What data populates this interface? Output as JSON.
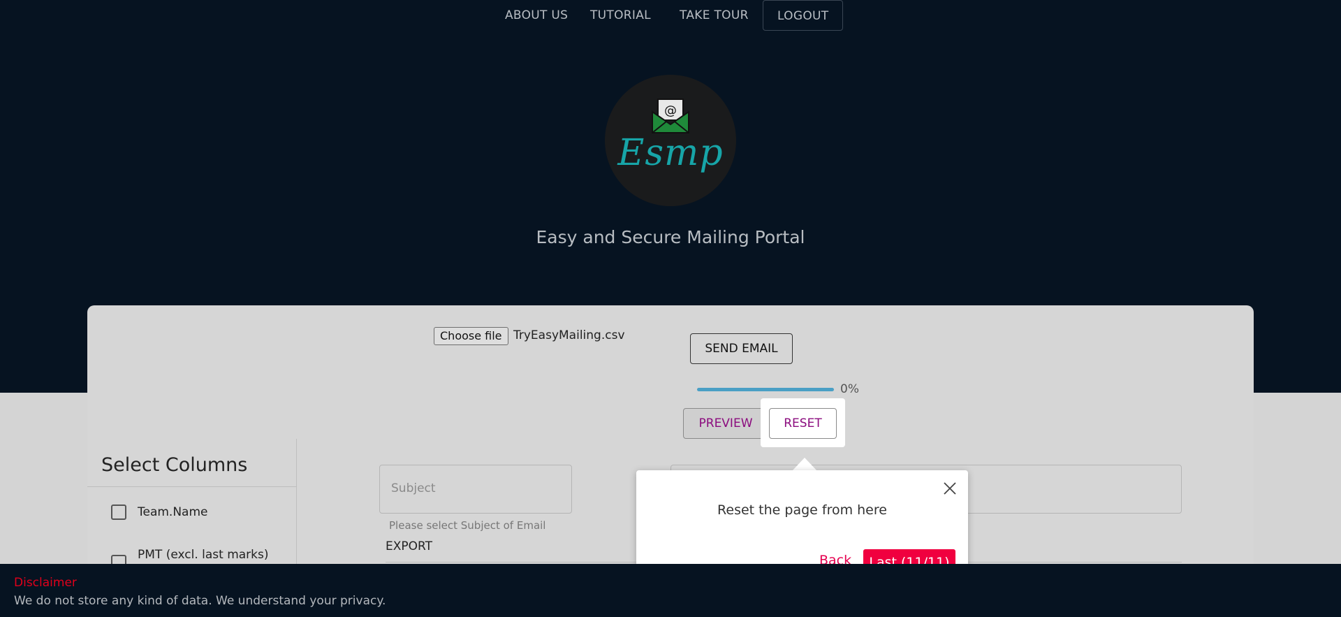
{
  "nav": {
    "items": [
      {
        "label": "ABOUT US"
      },
      {
        "label": "TUTORIAL"
      },
      {
        "label": "TAKE TOUR"
      },
      {
        "label": "LOGOUT"
      }
    ]
  },
  "brand": {
    "logo_text": "Esmp",
    "logo_icon": "envelope-at-icon",
    "tagline": "Easy and Secure Mailing Portal",
    "accent": "#17a5a8"
  },
  "upload": {
    "button_label": "Choose file",
    "file_name": "TryEasyMailing.csv"
  },
  "actions": {
    "send_label": "SEND EMAIL",
    "progress_value": 0,
    "progress_label": "0%",
    "preview_label": "PREVIEW",
    "reset_label": "RESET",
    "button_text_color": "#8b0c7e"
  },
  "columns_panel": {
    "title": "Select Columns",
    "items": [
      {
        "label": "Team.Name",
        "checked": false
      },
      {
        "label": "PMT (excl. last marks)",
        "checked": false
      }
    ]
  },
  "form": {
    "subject_placeholder": "Subject",
    "subject_help": "Please select Subject of Email",
    "export_label": "EXPORT"
  },
  "tour": {
    "message": "Reset the page from here",
    "back_label": "Back",
    "last_label": "Last (11/11)",
    "close_icon": "close-icon",
    "accent": "#f0003f"
  },
  "footer": {
    "title": "Disclaimer",
    "text": "We do not store any kind of data. We understand your privacy.",
    "title_color": "#e0001b"
  }
}
